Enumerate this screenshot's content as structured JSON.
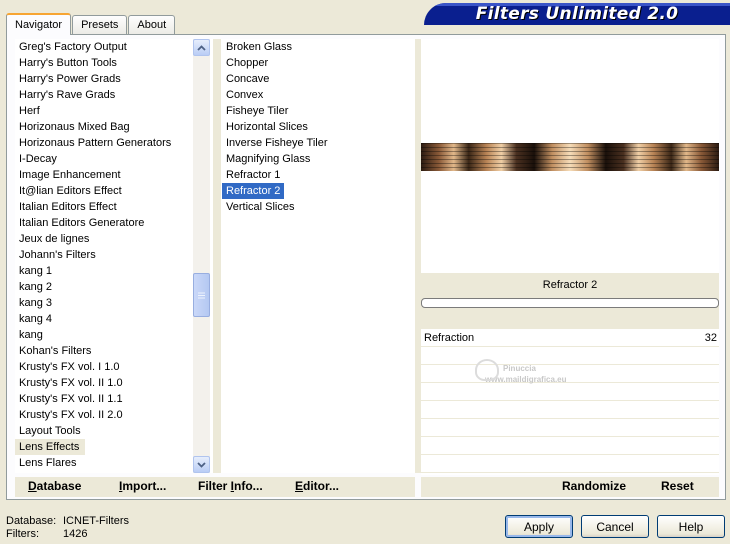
{
  "tabs": [
    {
      "label": "Navigator",
      "active": true
    },
    {
      "label": "Presets",
      "active": false
    },
    {
      "label": "About",
      "active": false
    }
  ],
  "banner": {
    "title": "Filters Unlimited 2.0"
  },
  "categories": [
    "Greg's Factory Output",
    "Harry's Button Tools",
    "Harry's Power Grads",
    "Harry's Rave Grads",
    "Herf",
    "Horizonaus Mixed Bag",
    "Horizonaus Pattern Generators",
    "I-Decay",
    "Image Enhancement",
    "It@lian Editors Effect",
    "Italian Editors Effect",
    "Italian Editors Generatore",
    "Jeux de lignes",
    "Johann's Filters",
    "kang 1",
    "kang 2",
    "kang 3",
    "kang 4",
    "kang",
    "Kohan's Filters",
    "Krusty's FX vol. I 1.0",
    "Krusty's FX vol. II 1.0",
    "Krusty's FX vol. II 1.1",
    "Krusty's FX vol. II 2.0",
    "Layout Tools",
    "Lens Effects",
    "Lens Flares"
  ],
  "selected_category": "Lens Effects",
  "filters": [
    "Broken Glass",
    "Chopper",
    "Concave",
    "Convex",
    "Fisheye Tiler",
    "Horizontal Slices",
    "Inverse Fisheye Tiler",
    "Magnifying Glass",
    "Refractor 1",
    "Refractor 2",
    "Vertical Slices"
  ],
  "selected_filter": "Refractor 2",
  "preview": {
    "filter_name": "Refractor 2"
  },
  "params": [
    {
      "name": "Refraction",
      "value": "32"
    }
  ],
  "watermark": {
    "line1": "Pinuccia",
    "line2": "www.maildigrafica.eu"
  },
  "left_buttons": {
    "database": {
      "mnemonic": "D",
      "rest": "atabase"
    },
    "import": {
      "mnemonic": "I",
      "rest": "mport..."
    },
    "filter_info": {
      "pre": "Filter ",
      "mnemonic": "I",
      "rest": "nfo..."
    },
    "editor": {
      "mnemonic": "E",
      "rest": "ditor..."
    }
  },
  "right_buttons": {
    "randomize": "Randomize",
    "reset": "Reset"
  },
  "status": {
    "database_label": "Database:",
    "database_value": "ICNET-Filters",
    "filters_label": "Filters:",
    "filters_value": "1426"
  },
  "dialog_buttons": {
    "apply": "Apply",
    "cancel": "Cancel",
    "help": "Help"
  },
  "colors": {
    "selection": "#316ac5",
    "banner": "#0a1f8f",
    "face": "#ece9d8"
  }
}
